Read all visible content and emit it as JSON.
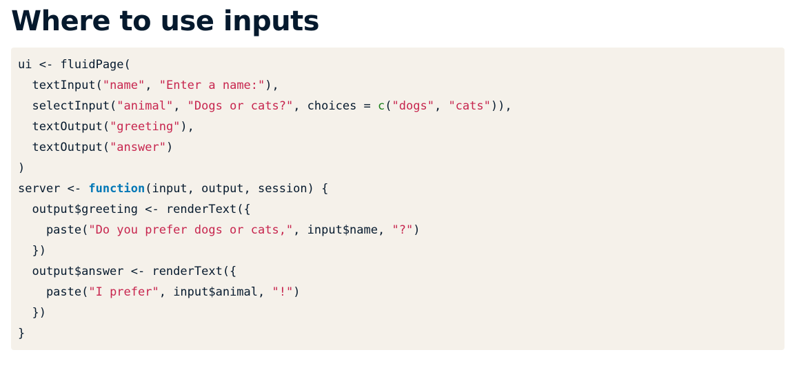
{
  "page": {
    "title": "Where to use inputs"
  },
  "code": {
    "language": "r",
    "lines": [
      [
        {
          "t": "plain",
          "v": "ui <- fluidPage("
        }
      ],
      [
        {
          "t": "plain",
          "v": "  textInput("
        },
        {
          "t": "str",
          "v": "\"name\""
        },
        {
          "t": "plain",
          "v": ", "
        },
        {
          "t": "str",
          "v": "\"Enter a name:\""
        },
        {
          "t": "plain",
          "v": "),"
        }
      ],
      [
        {
          "t": "plain",
          "v": "  selectInput("
        },
        {
          "t": "str",
          "v": "\"animal\""
        },
        {
          "t": "plain",
          "v": ", "
        },
        {
          "t": "str",
          "v": "\"Dogs or cats?\""
        },
        {
          "t": "plain",
          "v": ", choices = "
        },
        {
          "t": "fnc",
          "v": "c"
        },
        {
          "t": "plain",
          "v": "("
        },
        {
          "t": "str",
          "v": "\"dogs\""
        },
        {
          "t": "plain",
          "v": ", "
        },
        {
          "t": "str",
          "v": "\"cats\""
        },
        {
          "t": "plain",
          "v": ")),"
        }
      ],
      [
        {
          "t": "plain",
          "v": "  textOutput("
        },
        {
          "t": "str",
          "v": "\"greeting\""
        },
        {
          "t": "plain",
          "v": "),"
        }
      ],
      [
        {
          "t": "plain",
          "v": "  textOutput("
        },
        {
          "t": "str",
          "v": "\"answer\""
        },
        {
          "t": "plain",
          "v": ")"
        }
      ],
      [
        {
          "t": "plain",
          "v": ")"
        }
      ],
      [
        {
          "t": "plain",
          "v": "server <- "
        },
        {
          "t": "kw",
          "v": "function"
        },
        {
          "t": "plain",
          "v": "(input, output, session) {"
        }
      ],
      [
        {
          "t": "plain",
          "v": "  output$greeting <- renderText({"
        }
      ],
      [
        {
          "t": "plain",
          "v": "    paste("
        },
        {
          "t": "str",
          "v": "\"Do you prefer dogs or cats,\""
        },
        {
          "t": "plain",
          "v": ", input$name, "
        },
        {
          "t": "str",
          "v": "\"?\""
        },
        {
          "t": "plain",
          "v": ")"
        }
      ],
      [
        {
          "t": "plain",
          "v": "  })"
        }
      ],
      [
        {
          "t": "plain",
          "v": "  output$answer <- renderText({"
        }
      ],
      [
        {
          "t": "plain",
          "v": "    paste("
        },
        {
          "t": "str",
          "v": "\"I prefer\""
        },
        {
          "t": "plain",
          "v": ", input$animal, "
        },
        {
          "t": "str",
          "v": "\"!\""
        },
        {
          "t": "plain",
          "v": ")"
        }
      ],
      [
        {
          "t": "plain",
          "v": "  })"
        }
      ],
      [
        {
          "t": "plain",
          "v": "}"
        }
      ]
    ]
  },
  "colors": {
    "heading": "#05192d",
    "code_background": "#f5f1ea",
    "string": "#c7254e",
    "keyword": "#0077b6",
    "builtin_c": "#1a7f1a"
  }
}
